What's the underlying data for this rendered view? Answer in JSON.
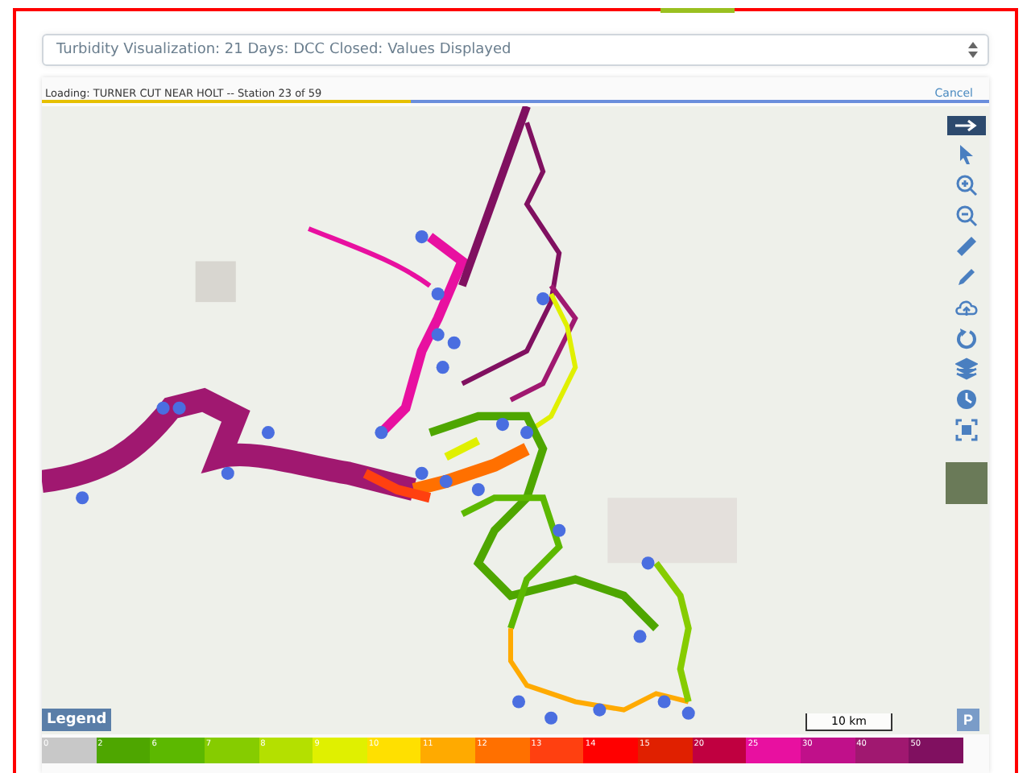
{
  "dropdown": {
    "value": "Turbidity Visualization: 21 Days: DCC Closed: Values Displayed"
  },
  "loading": {
    "text": "Loading: TURNER CUT NEAR HOLT -- Station 23 of 59",
    "level": 0.39
  },
  "cancel_link": "Cancel",
  "map": {
    "scale_label": "10 km",
    "legend_button": "Legend",
    "p_button": "P"
  },
  "legend": [
    {
      "label": "0",
      "color": "#c8c8c8"
    },
    {
      "label": "2",
      "color": "#4ea600"
    },
    {
      "label": "6",
      "color": "#5cb800"
    },
    {
      "label": "7",
      "color": "#86cc00"
    },
    {
      "label": "8",
      "color": "#b4e000"
    },
    {
      "label": "9",
      "color": "#e0f000"
    },
    {
      "label": "10",
      "color": "#ffe000"
    },
    {
      "label": "11",
      "color": "#ffaa00"
    },
    {
      "label": "12",
      "color": "#ff7000"
    },
    {
      "label": "13",
      "color": "#ff4010"
    },
    {
      "label": "14",
      "color": "#ff0000"
    },
    {
      "label": "15",
      "color": "#e02000"
    },
    {
      "label": "20",
      "color": "#c00040"
    },
    {
      "label": "25",
      "color": "#e810a0"
    },
    {
      "label": "30",
      "color": "#c0108a"
    },
    {
      "label": "40",
      "color": "#a01870"
    },
    {
      "label": "50",
      "color": "#801060"
    }
  ]
}
